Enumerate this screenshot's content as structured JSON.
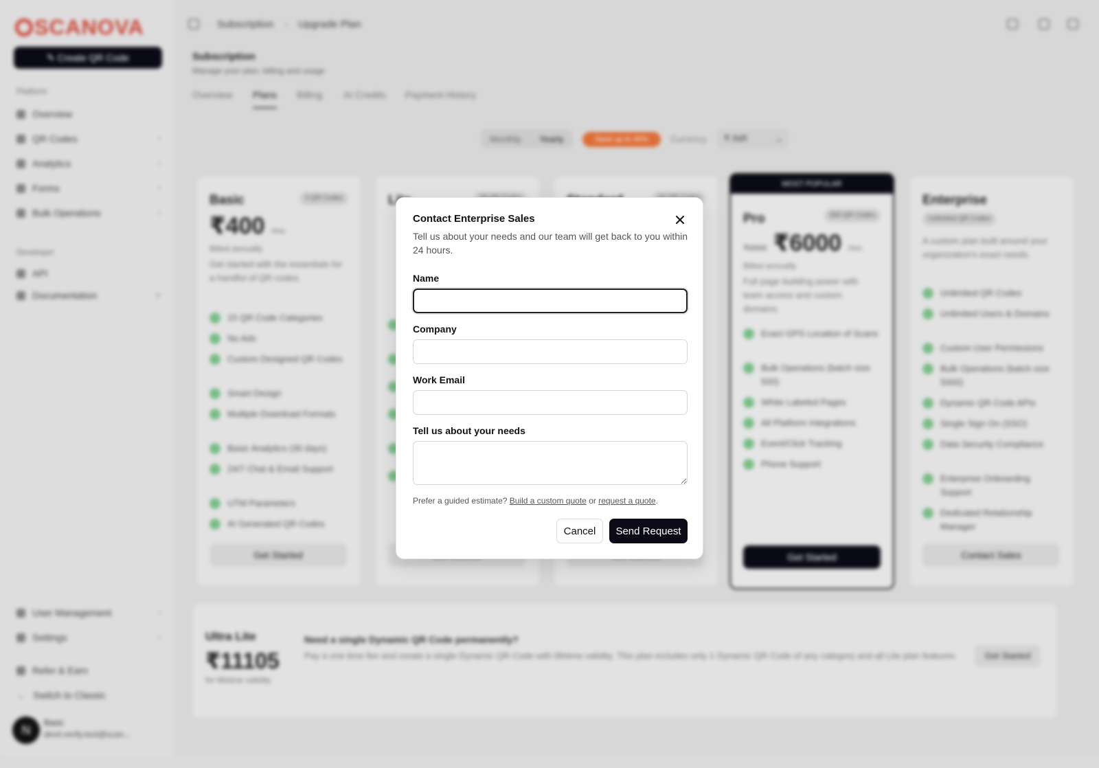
{
  "sidebar": {
    "brand": "SCANOVA",
    "create_label": "Create QR Code",
    "platform_label": "Platform",
    "platform_items": [
      {
        "label": "Overview"
      },
      {
        "label": "QR Codes"
      },
      {
        "label": "Analytics"
      },
      {
        "label": "Forms"
      },
      {
        "label": "Bulk Operations"
      }
    ],
    "developer_label": "Developer",
    "developer_items": [
      {
        "label": "API"
      },
      {
        "label": "Documentation"
      }
    ],
    "bottom_items": [
      {
        "label": "User Management"
      },
      {
        "label": "Settings"
      },
      {
        "label": "Refer & Earn"
      },
      {
        "label": "Switch to Classic"
      }
    ],
    "user": {
      "initial": "N",
      "name": "Basic",
      "email": "devil.verify.test@scan..."
    }
  },
  "topbar": {
    "breadcrumb": [
      "Subscription",
      "Upgrade Plan"
    ],
    "separator": "›"
  },
  "page": {
    "title": "Subscription",
    "subtitle": "Manage your plan, billing and usage",
    "tabs": [
      "Overview",
      "Plans",
      "Billing",
      "AI Credits",
      "Payment History"
    ],
    "active_tab": "Plans",
    "billing_options": [
      "Monthly",
      "Yearly"
    ],
    "save_badge": "Save up to 40%",
    "currency_label": "Currency",
    "currency_value": "₹ INR"
  },
  "plans": [
    {
      "name": "Basic",
      "badge": "3 QR Codes",
      "price": "₹400",
      "period": "/mo",
      "billed": "Billed annually",
      "description": "Get started with the essentials for a handful of QR codes.",
      "features": [
        "15 QR Code Categories",
        "No Ads",
        "Custom Designed QR Codes",
        "Smart Design",
        "Multiple Download Formats",
        "Basic Analytics (30 days)",
        "24/7 Chat & Email Support",
        "UTM Parameters",
        "AI Generated QR Codes"
      ],
      "cta": "Get Started"
    },
    {
      "name": "Lite",
      "badge": "25 QR Codes",
      "cta": "Get Started",
      "features": [
        "",
        "",
        "",
        "",
        "",
        "",
        "",
        ""
      ]
    },
    {
      "name": "Standard",
      "badge": "50 QR Codes",
      "cta": "Get Started",
      "features": []
    },
    {
      "name": "Pro",
      "badge": "500 QR Codes",
      "popular": "MOST POPULAR",
      "old_price": "₹9000",
      "price": "₹6000",
      "period": "/mo",
      "billed": "Billed annually",
      "description": "Full page building power with team access and custom domains.",
      "features": [
        "Exact GPS Location of Scans",
        "Bulk Operations (batch size 500)",
        "White Labeled Pages",
        "All Platform Integrations",
        "Event/Click Tracking",
        "Phone Support"
      ],
      "cta": "Get Started"
    },
    {
      "name": "Enterprise",
      "badge": "Unlimited QR Codes",
      "description": "A custom plan built around your organization's exact needs.",
      "features": [
        "Unlimited QR Codes",
        "Unlimited Users & Domains",
        "Custom User Permissions",
        "Bulk Operations (batch size 5000)",
        "Dynamic QR Code APIs",
        "Single Sign On (SSO)",
        "Data Security Compliance",
        "Enterprise Onboarding Support",
        "Dedicated Relationship Manager"
      ],
      "cta": "Contact Sales"
    }
  ],
  "ultra": {
    "name": "Ultra Lite",
    "price": "₹11105",
    "sub": "for lifetime validity",
    "question": "Need a single Dynamic QR Code permanently?",
    "text": "Pay a one time fee and create a single Dynamic QR Code with lifetime validity. This plan includes only 1 Dynamic QR Code of any category and all Lite plan features.",
    "cta": "Get Started"
  },
  "modal": {
    "title": "Contact Enterprise Sales",
    "description": "Tell us about your needs and our team will get back to you within 24 hours.",
    "fields": {
      "name": {
        "label": "Name",
        "value": "",
        "placeholder": ""
      },
      "company": {
        "label": "Company",
        "value": "",
        "placeholder": ""
      },
      "email": {
        "label": "Work Email",
        "value": "",
        "placeholder": ""
      },
      "needs": {
        "label": "Tell us about your needs",
        "value": "",
        "placeholder": ""
      }
    },
    "guided_prefix": "Prefer a guided estimate?",
    "custom_quote_link": "Build a custom quote",
    "or_text": "or",
    "request_quote_link": "request a quote",
    "period": ".",
    "cancel_label": "Cancel",
    "send_label": "Send Request"
  }
}
